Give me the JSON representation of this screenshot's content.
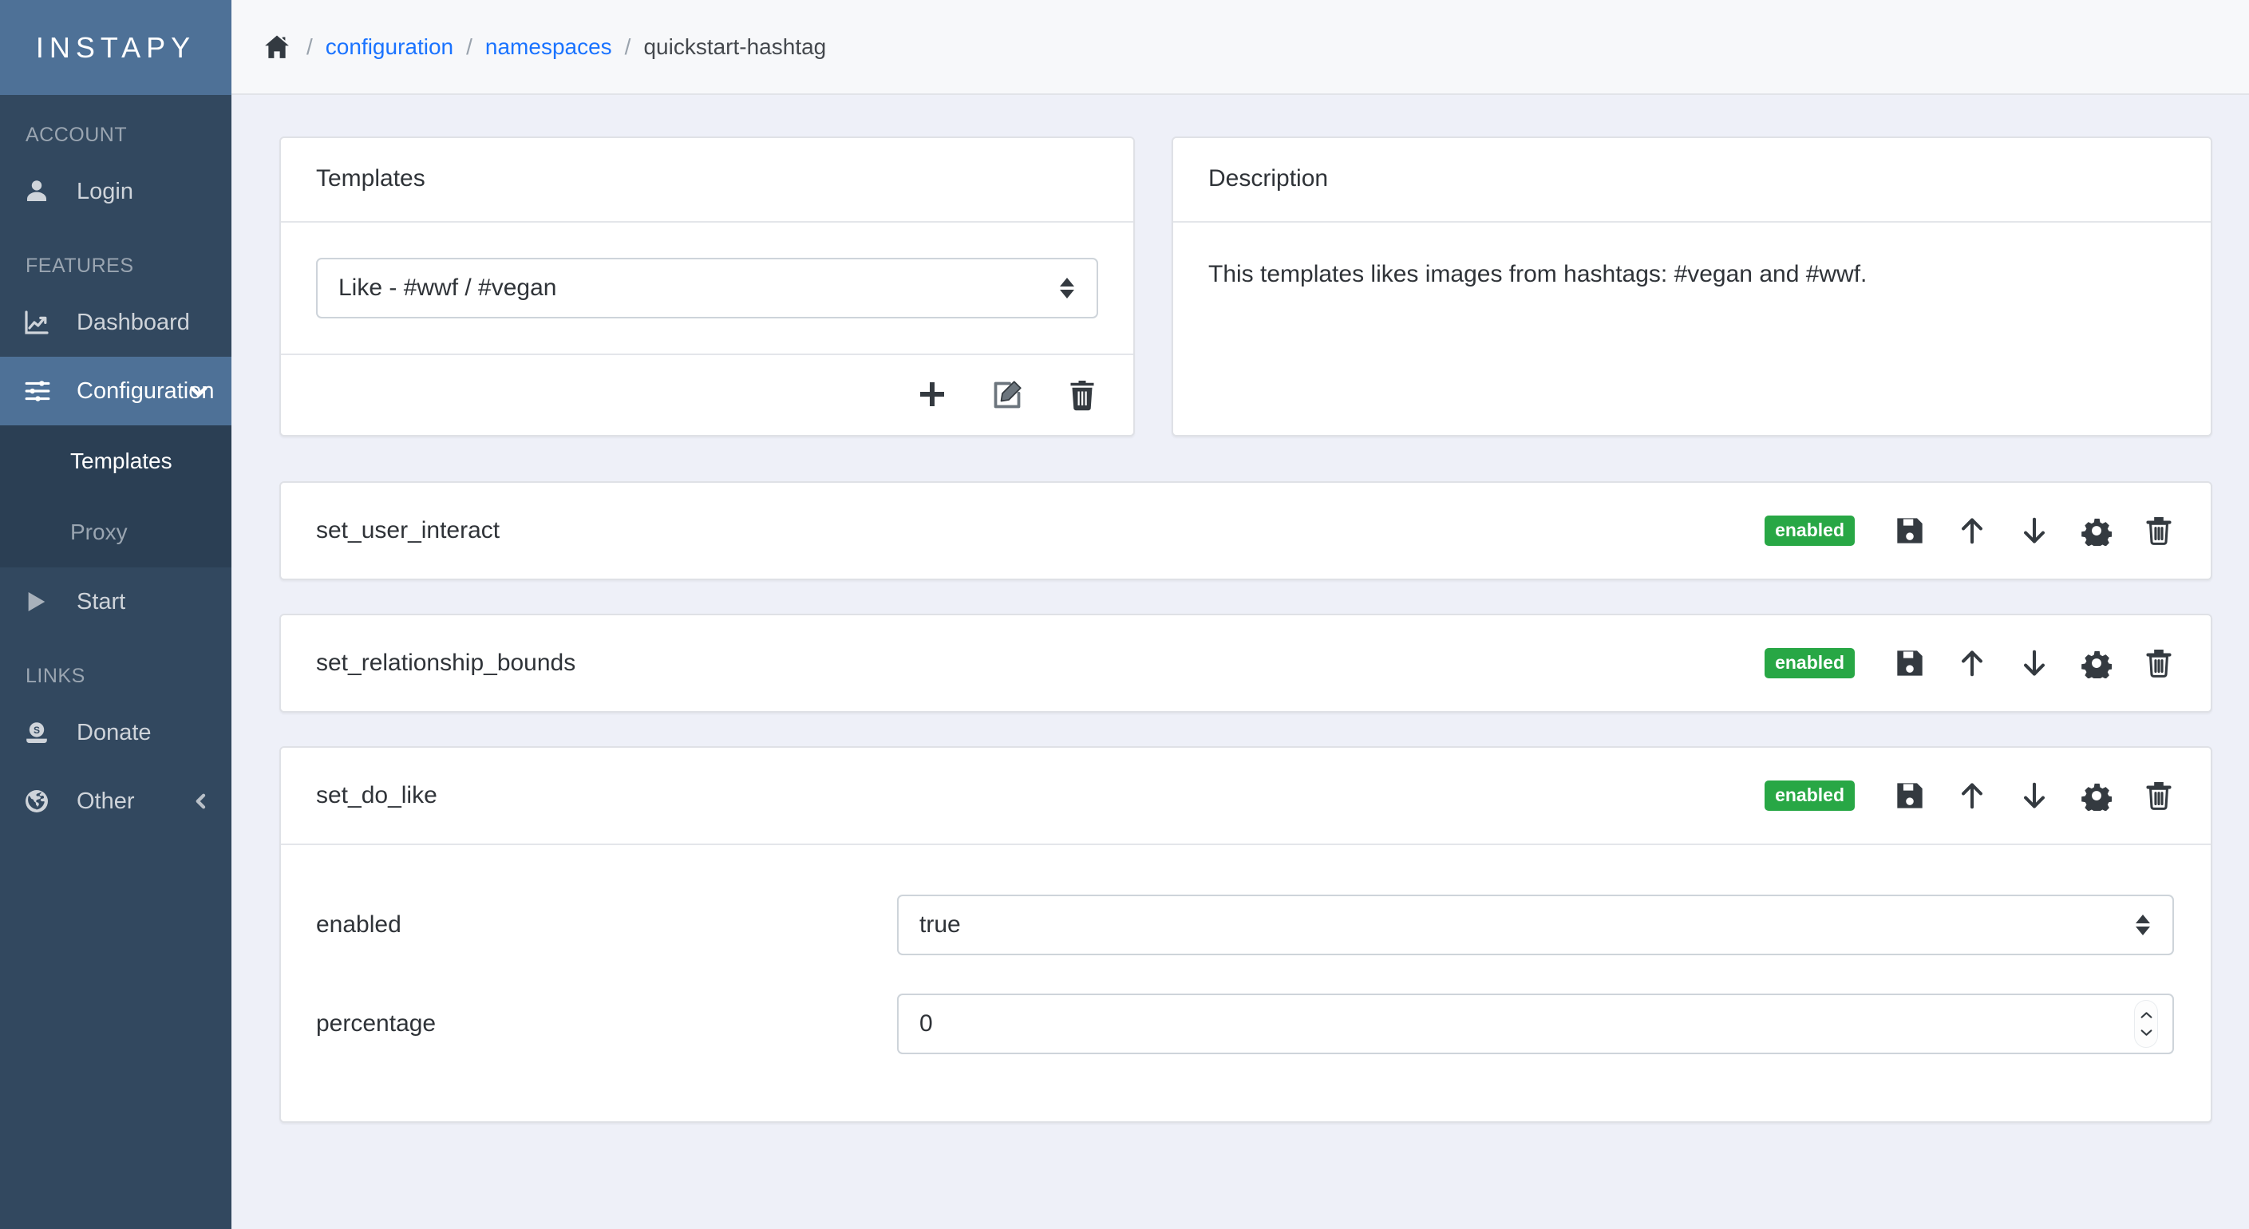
{
  "brand": {
    "title": "INSTAPY"
  },
  "sidebar": {
    "sections": [
      {
        "title": "ACCOUNT"
      },
      {
        "title": "FEATURES"
      },
      {
        "title": "LINKS"
      }
    ],
    "items": {
      "login": {
        "label": "Login",
        "icon": "user-icon"
      },
      "dashboard": {
        "label": "Dashboard",
        "icon": "chart-line-icon"
      },
      "configuration": {
        "label": "Configuration",
        "icon": "sliders-icon",
        "caret": "chevron-down-icon"
      },
      "templates": {
        "label": "Templates"
      },
      "proxy": {
        "label": "Proxy"
      },
      "start": {
        "label": "Start",
        "icon": "play-icon"
      },
      "donate": {
        "label": "Donate",
        "icon": "money-icon"
      },
      "other": {
        "label": "Other",
        "icon": "globe-icon",
        "caret": "chevron-left-icon"
      }
    }
  },
  "breadcrumb": {
    "home_icon": "home-icon",
    "sep": "/",
    "configuration": "configuration",
    "namespaces": "namespaces",
    "current": "quickstart-hashtag"
  },
  "templates_card": {
    "title": "Templates",
    "selected_template": "Like - #wwf / #vegan",
    "options": [
      "Like - #wwf / #vegan"
    ],
    "footer_buttons": [
      {
        "name": "add-template-button",
        "icon": "plus-icon"
      },
      {
        "name": "edit-template-button",
        "icon": "pencil-square-icon"
      },
      {
        "name": "delete-template-button",
        "icon": "trash-icon"
      }
    ]
  },
  "description_card": {
    "title": "Description",
    "text": "This templates likes images from hashtags: #vegan and #wwf."
  },
  "actions": [
    {
      "name": "set_user_interact",
      "status": "enabled",
      "expanded": false,
      "tools": [
        "save-icon",
        "arrow-up-icon",
        "arrow-down-icon",
        "gear-icon",
        "trash-icon"
      ]
    },
    {
      "name": "set_relationship_bounds",
      "status": "enabled",
      "expanded": false,
      "tools": [
        "save-icon",
        "arrow-up-icon",
        "arrow-down-icon",
        "gear-icon",
        "trash-icon"
      ]
    },
    {
      "name": "set_do_like",
      "status": "enabled",
      "expanded": true,
      "tools": [
        "save-icon",
        "arrow-up-icon",
        "arrow-down-icon",
        "gear-icon",
        "trash-icon"
      ],
      "fields": [
        {
          "label": "enabled",
          "type": "select",
          "value": "true",
          "options": [
            "true",
            "false"
          ]
        },
        {
          "label": "percentage",
          "type": "number",
          "value": "0"
        }
      ]
    }
  ],
  "colors": {
    "sidebar_bg": "#32485f",
    "sidebar_accent": "#4e7197",
    "submenu_bg": "#2b3f54",
    "page_bg": "#eef0f8",
    "link": "#1a73ff",
    "badge_green": "#28a745"
  }
}
